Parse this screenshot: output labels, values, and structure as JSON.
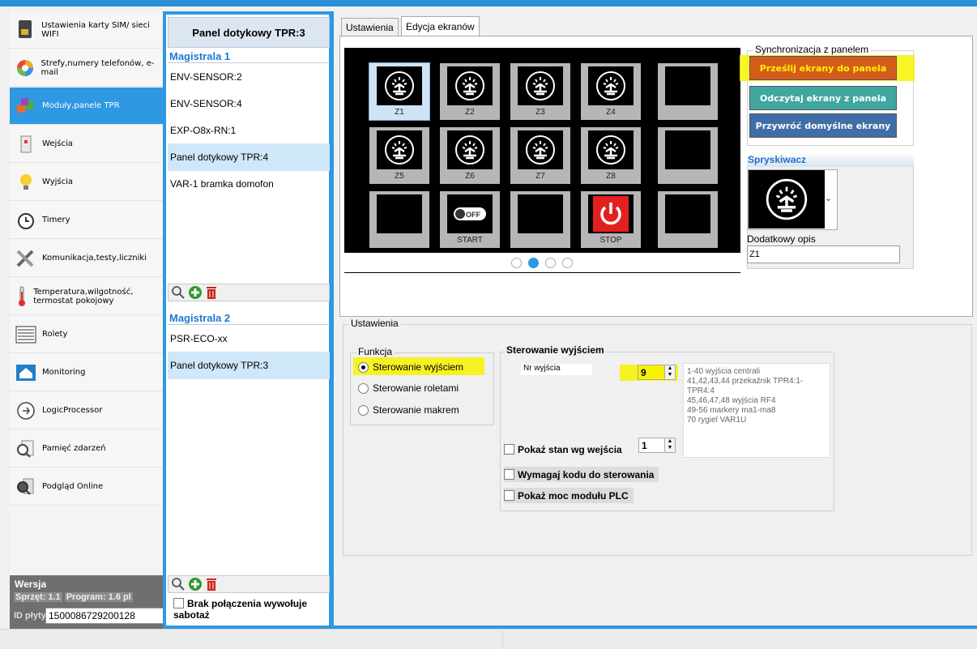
{
  "sidebar": {
    "items": [
      {
        "label": "Ustawienia karty SIM/ sieci WIFI",
        "icon": "sim-card-icon"
      },
      {
        "label": "Strefy,numery telefonów, e-mail",
        "icon": "zones-pie-icon"
      },
      {
        "label": "Moduły,panele TPR",
        "icon": "modules-cubes-icon",
        "active": true
      },
      {
        "label": "Wejścia",
        "icon": "door-sensor-icon"
      },
      {
        "label": "Wyjścia",
        "icon": "lightbulb-icon"
      },
      {
        "label": "Timery",
        "icon": "alarm-clock-icon"
      },
      {
        "label": "Komunikacja,testy,liczniki",
        "icon": "tools-icon"
      },
      {
        "label": "Temperatura,wilgotność, termostat pokojowy",
        "icon": "thermometer-icon"
      },
      {
        "label": "Rolety",
        "icon": "blinds-icon"
      },
      {
        "label": "Monitoring",
        "icon": "monitoring-house-icon"
      },
      {
        "label": "LogicProcessor",
        "icon": "logic-processor-icon"
      },
      {
        "label": "Pamięć zdarzeń",
        "icon": "event-log-icon"
      },
      {
        "label": "Podgląd Online",
        "icon": "online-preview-icon"
      }
    ],
    "version": {
      "title": "Wersja",
      "hw": "Sprzęt: 1.1",
      "prog": "Program: 1.6 pl",
      "id_label": "ID płyty",
      "id_value": "1500086729200128"
    }
  },
  "middle": {
    "header": "Panel dotykowy TPR:3",
    "bus1": {
      "title": "Magistrala 1",
      "items": [
        "ENV-SENSOR:2",
        "ENV-SENSOR:4",
        "EXP-O8x-RN:1",
        "Panel dotykowy TPR:4",
        "VAR-1 bramka domofon"
      ]
    },
    "bus2": {
      "title": "Magistrala 2",
      "items": [
        "PSR-ECO-xx",
        "Panel dotykowy TPR:3"
      ]
    },
    "sabotage_label": "Brak połączenia wywołuje sabotaż"
  },
  "tabs": [
    "Ustawienia",
    "Edycja ekranów"
  ],
  "screen": {
    "tiles": [
      {
        "label": "Z1",
        "icon": "sprinkler-icon",
        "selected": true
      },
      {
        "label": "Z2",
        "icon": "sprinkler-icon"
      },
      {
        "label": "Z3",
        "icon": "sprinkler-icon"
      },
      {
        "label": "Z4",
        "icon": "sprinkler-icon"
      },
      {
        "label": "",
        "icon": ""
      },
      {
        "label": "Z5",
        "icon": "sprinkler-icon"
      },
      {
        "label": "Z6",
        "icon": "sprinkler-icon"
      },
      {
        "label": "Z7",
        "icon": "sprinkler-icon"
      },
      {
        "label": "Z8",
        "icon": "sprinkler-icon"
      },
      {
        "label": "",
        "icon": ""
      },
      {
        "label": "",
        "icon": ""
      },
      {
        "label": "START",
        "icon": "off-toggle-icon"
      },
      {
        "label": "",
        "icon": ""
      },
      {
        "label": "STOP",
        "icon": "power-icon"
      },
      {
        "label": "",
        "icon": ""
      }
    ],
    "off_badge": "OFF",
    "page": 2,
    "pages": 4
  },
  "sync": {
    "title": "Synchronizacja z panelem",
    "send": "Prześlij ekrany do panela",
    "read": "Odczytaj ekrany z panela",
    "restore": "Przywróć domyślne ekrany",
    "colors": {
      "send": "#d55d1b",
      "read": "#3fa7a0",
      "restore": "#3f6ea8"
    }
  },
  "sprinkler": {
    "title": "Spryskiwacz",
    "desc_label": "Dodatkowy opis",
    "desc_value": "Z1"
  },
  "settings": {
    "title": "Ustawienia",
    "func_title": "Funkcja",
    "functions": [
      "Sterowanie wyjściem",
      "Sterowanie roletami",
      "Sterowanie makrem"
    ],
    "selected_function": 0,
    "out_title": "Sterowanie wyjściem",
    "nr_label": "Nr wyjścia",
    "nr_value": "9",
    "hint_lines": [
      "1-40 wyjścia centrali",
      "41,42,43,44 przekaźnik TPR4:1-TPR4:4",
      "45,46,47,48 wyjścia RF4",
      "49-56 markery ma1-ma8",
      "70 rygiel VAR1U"
    ],
    "show_state_label": "Pokaż stan wg wejścia",
    "show_state_value": "1",
    "require_code_label": "Wymagaj kodu do sterowania",
    "show_power_label": "Pokaż moc modułu PLC"
  },
  "accent": "#2e98e3",
  "highlight": "#f7f200"
}
